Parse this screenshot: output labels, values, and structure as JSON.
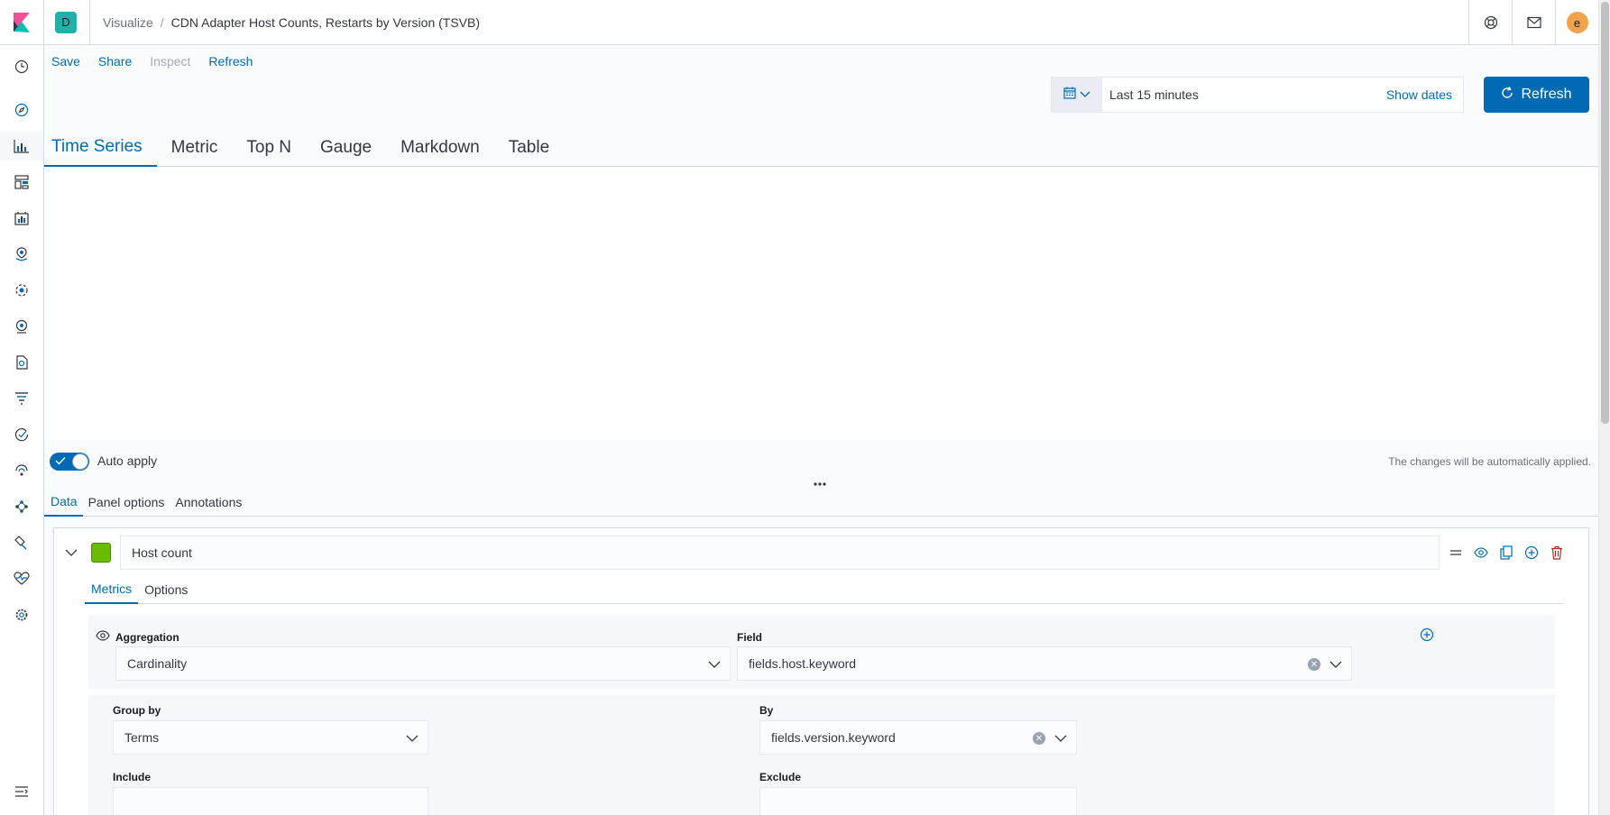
{
  "header": {
    "space_initial": "D",
    "breadcrumbs": [
      "Visualize",
      "CDN Adapter Host Counts, Restarts by Version (TSVB)"
    ],
    "breadcrumb_sep": "/",
    "user_initial": "e",
    "icons": [
      "kibana-logo-icon",
      "help-icon",
      "mail-icon"
    ]
  },
  "leftnav": {
    "items": [
      "recent-icon",
      "discover-icon",
      "visualize-icon",
      "dashboard-icon",
      "canvas-icon",
      "maps-icon",
      "ml-icon",
      "infrastructure-icon",
      "logs-icon",
      "apm-icon",
      "uptime-icon",
      "siem-icon",
      "dev-tools-icon",
      "stack-monitoring-icon",
      "management-icon"
    ],
    "active": "visualize-icon",
    "collapse": "menu-collapse-icon"
  },
  "topnav": {
    "save": "Save",
    "share": "Share",
    "inspect": "Inspect",
    "refresh": "Refresh"
  },
  "querybar": {
    "range": "Last 15 minutes",
    "show_dates": "Show dates",
    "refresh_button": "Refresh"
  },
  "vis_tabs": [
    "Time Series",
    "Metric",
    "Top N",
    "Gauge",
    "Markdown",
    "Table"
  ],
  "vis_tabs_active": "Time Series",
  "auto_apply": {
    "label": "Auto apply",
    "enabled": true,
    "note": "The changes will be automatically applied."
  },
  "panel_tabs": [
    "Data",
    "Panel options",
    "Annotations"
  ],
  "panel_tabs_active": "Data",
  "series": {
    "color": "#68bc00",
    "label": "Host count",
    "tabs": [
      "Metrics",
      "Options"
    ],
    "tabs_active": "Metrics",
    "metric": {
      "aggregation_label": "Aggregation",
      "aggregation_value": "Cardinality",
      "field_label": "Field",
      "field_value": "fields.host.keyword"
    },
    "group": {
      "group_by_label": "Group by",
      "group_by_value": "Terms",
      "by_label": "By",
      "by_value": "fields.version.keyword",
      "include_label": "Include",
      "exclude_label": "Exclude"
    }
  },
  "colors": {
    "accent": "#006bb4",
    "danger": "#bd271e"
  }
}
